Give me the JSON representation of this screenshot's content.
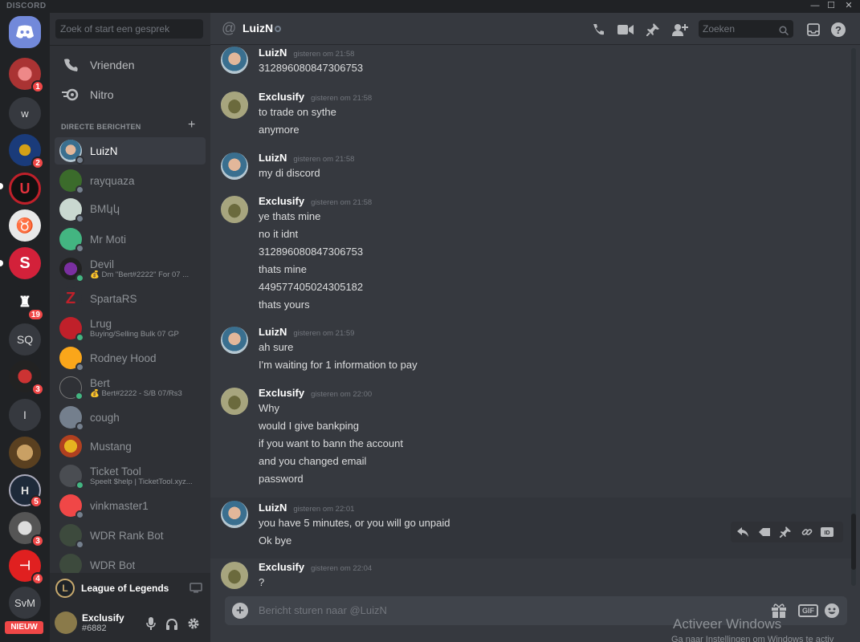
{
  "window": {
    "brand": "DISCORD",
    "minimize": "—",
    "maximize": "☐",
    "close": "✕"
  },
  "guilds": [
    {
      "name": "home",
      "label": "",
      "badge": ""
    },
    {
      "name": "server-1",
      "label": "",
      "badge": "1"
    },
    {
      "name": "server-w",
      "label": "w",
      "badge": ""
    },
    {
      "name": "server-3",
      "label": "",
      "badge": "2"
    },
    {
      "name": "server-4",
      "label": "",
      "badge": ""
    },
    {
      "name": "server-5",
      "label": "",
      "badge": ""
    },
    {
      "name": "server-6",
      "label": "",
      "badge": ""
    },
    {
      "name": "server-7",
      "label": "",
      "badge": "19"
    },
    {
      "name": "server-sq",
      "label": "SQ",
      "badge": ""
    },
    {
      "name": "server-9",
      "label": "",
      "badge": "3"
    },
    {
      "name": "server-i",
      "label": "I",
      "badge": ""
    },
    {
      "name": "server-11",
      "label": "",
      "badge": ""
    },
    {
      "name": "server-12",
      "label": "",
      "badge": "5"
    },
    {
      "name": "server-13",
      "label": "",
      "badge": "3"
    },
    {
      "name": "server-14",
      "label": "",
      "badge": "4"
    },
    {
      "name": "server-svm",
      "label": "SvM",
      "badge": ""
    }
  ],
  "guild_new_label": "NIEUW",
  "sidebar": {
    "search_placeholder": "Zoek of start een gesprek",
    "nav": [
      {
        "label": "Vrienden"
      },
      {
        "label": "Nitro"
      }
    ],
    "dm_header": "DIRECTE BERICHTEN",
    "dms": [
      {
        "name": "LuizN",
        "sub": ""
      },
      {
        "name": "rayquaza",
        "sub": ""
      },
      {
        "name": "BMկկ",
        "sub": ""
      },
      {
        "name": "Mr Moti",
        "sub": ""
      },
      {
        "name": "Devil",
        "sub": "💰 Dm \"Bert#2222\" For 07 ..."
      },
      {
        "name": "SpartaRS",
        "sub": ""
      },
      {
        "name": "Lrug",
        "sub": "Buying/Selling Bulk 07 GP"
      },
      {
        "name": "Rodney Hood",
        "sub": ""
      },
      {
        "name": "Bert",
        "sub": "💰 Bert#2222 - S/B 07/Rs3"
      },
      {
        "name": "cough",
        "sub": ""
      },
      {
        "name": "Mustang",
        "sub": ""
      },
      {
        "name": "Ticket Tool",
        "sub": "Speelt $help | TicketTool.xyz..."
      },
      {
        "name": "vinkmaster1",
        "sub": ""
      },
      {
        "name": "WDR Rank Bot",
        "sub": ""
      },
      {
        "name": "WDR Bot",
        "sub": ""
      }
    ],
    "activity_game": "League of Legends",
    "activity_icon_text": "L",
    "user": {
      "name": "Exclusify",
      "tag": "#6882"
    }
  },
  "header": {
    "channel": "LuizN",
    "search_placeholder": "Zoeken"
  },
  "messages": [
    {
      "author": "LuizN",
      "time": "gisteren om 21:58",
      "lines": [
        "312896080847306753"
      ]
    },
    {
      "author": "Exclusify",
      "time": "gisteren om 21:58",
      "lines": [
        "to trade on sythe",
        "anymore"
      ]
    },
    {
      "author": "LuizN",
      "time": "gisteren om 21:58",
      "lines": [
        "my di discord"
      ]
    },
    {
      "author": "Exclusify",
      "time": "gisteren om 21:58",
      "lines": [
        "ye thats mine",
        "no it idnt",
        "312896080847306753",
        "thats mine",
        "449577405024305182",
        "thats yours"
      ]
    },
    {
      "author": "LuizN",
      "time": "gisteren om 21:59",
      "lines": [
        "ah sure",
        "I'm waiting for 1 information to pay"
      ]
    },
    {
      "author": "Exclusify",
      "time": "gisteren om 22:00",
      "lines": [
        "Why",
        "would I give bankping",
        "if you want to bann the account",
        "and you changed email",
        "password"
      ]
    },
    {
      "author": "LuizN",
      "time": "gisteren om 22:01",
      "lines": [
        "you have 5 minutes, or you will go unpaid",
        "Ok bye"
      ]
    },
    {
      "author": "Exclusify",
      "time": "gisteren om 22:04",
      "lines": [
        "?"
      ]
    }
  ],
  "composer": {
    "placeholder": "Bericht sturen naar @LuizN",
    "gif_label": "GIF"
  },
  "watermark": {
    "title": "Activeer Windows",
    "subtitle": "Ga naar Instellingen om Windows te activ"
  }
}
